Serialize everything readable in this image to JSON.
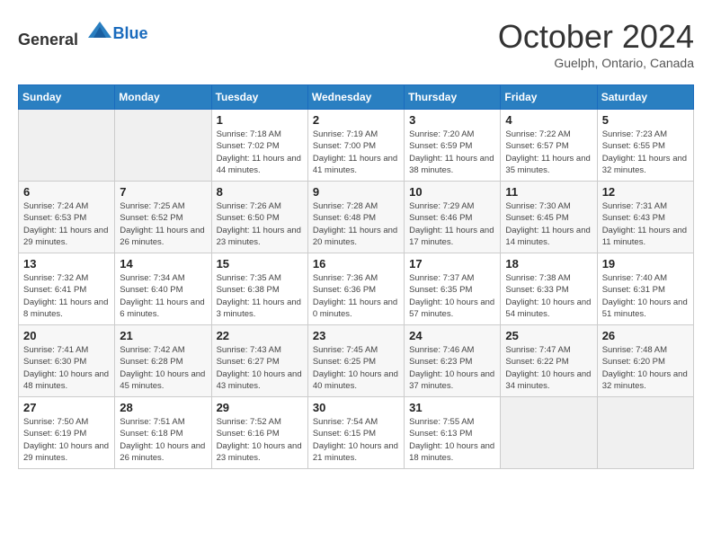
{
  "header": {
    "logo_general": "General",
    "logo_blue": "Blue",
    "month_title": "October 2024",
    "subtitle": "Guelph, Ontario, Canada"
  },
  "days_of_week": [
    "Sunday",
    "Monday",
    "Tuesday",
    "Wednesday",
    "Thursday",
    "Friday",
    "Saturday"
  ],
  "weeks": [
    [
      {
        "day": "",
        "sunrise": "",
        "sunset": "",
        "daylight": "",
        "empty": true
      },
      {
        "day": "",
        "sunrise": "",
        "sunset": "",
        "daylight": "",
        "empty": true
      },
      {
        "day": "1",
        "sunrise": "Sunrise: 7:18 AM",
        "sunset": "Sunset: 7:02 PM",
        "daylight": "Daylight: 11 hours and 44 minutes."
      },
      {
        "day": "2",
        "sunrise": "Sunrise: 7:19 AM",
        "sunset": "Sunset: 7:00 PM",
        "daylight": "Daylight: 11 hours and 41 minutes."
      },
      {
        "day": "3",
        "sunrise": "Sunrise: 7:20 AM",
        "sunset": "Sunset: 6:59 PM",
        "daylight": "Daylight: 11 hours and 38 minutes."
      },
      {
        "day": "4",
        "sunrise": "Sunrise: 7:22 AM",
        "sunset": "Sunset: 6:57 PM",
        "daylight": "Daylight: 11 hours and 35 minutes."
      },
      {
        "day": "5",
        "sunrise": "Sunrise: 7:23 AM",
        "sunset": "Sunset: 6:55 PM",
        "daylight": "Daylight: 11 hours and 32 minutes."
      }
    ],
    [
      {
        "day": "6",
        "sunrise": "Sunrise: 7:24 AM",
        "sunset": "Sunset: 6:53 PM",
        "daylight": "Daylight: 11 hours and 29 minutes."
      },
      {
        "day": "7",
        "sunrise": "Sunrise: 7:25 AM",
        "sunset": "Sunset: 6:52 PM",
        "daylight": "Daylight: 11 hours and 26 minutes."
      },
      {
        "day": "8",
        "sunrise": "Sunrise: 7:26 AM",
        "sunset": "Sunset: 6:50 PM",
        "daylight": "Daylight: 11 hours and 23 minutes."
      },
      {
        "day": "9",
        "sunrise": "Sunrise: 7:28 AM",
        "sunset": "Sunset: 6:48 PM",
        "daylight": "Daylight: 11 hours and 20 minutes."
      },
      {
        "day": "10",
        "sunrise": "Sunrise: 7:29 AM",
        "sunset": "Sunset: 6:46 PM",
        "daylight": "Daylight: 11 hours and 17 minutes."
      },
      {
        "day": "11",
        "sunrise": "Sunrise: 7:30 AM",
        "sunset": "Sunset: 6:45 PM",
        "daylight": "Daylight: 11 hours and 14 minutes."
      },
      {
        "day": "12",
        "sunrise": "Sunrise: 7:31 AM",
        "sunset": "Sunset: 6:43 PM",
        "daylight": "Daylight: 11 hours and 11 minutes."
      }
    ],
    [
      {
        "day": "13",
        "sunrise": "Sunrise: 7:32 AM",
        "sunset": "Sunset: 6:41 PM",
        "daylight": "Daylight: 11 hours and 8 minutes."
      },
      {
        "day": "14",
        "sunrise": "Sunrise: 7:34 AM",
        "sunset": "Sunset: 6:40 PM",
        "daylight": "Daylight: 11 hours and 6 minutes."
      },
      {
        "day": "15",
        "sunrise": "Sunrise: 7:35 AM",
        "sunset": "Sunset: 6:38 PM",
        "daylight": "Daylight: 11 hours and 3 minutes."
      },
      {
        "day": "16",
        "sunrise": "Sunrise: 7:36 AM",
        "sunset": "Sunset: 6:36 PM",
        "daylight": "Daylight: 11 hours and 0 minutes."
      },
      {
        "day": "17",
        "sunrise": "Sunrise: 7:37 AM",
        "sunset": "Sunset: 6:35 PM",
        "daylight": "Daylight: 10 hours and 57 minutes."
      },
      {
        "day": "18",
        "sunrise": "Sunrise: 7:38 AM",
        "sunset": "Sunset: 6:33 PM",
        "daylight": "Daylight: 10 hours and 54 minutes."
      },
      {
        "day": "19",
        "sunrise": "Sunrise: 7:40 AM",
        "sunset": "Sunset: 6:31 PM",
        "daylight": "Daylight: 10 hours and 51 minutes."
      }
    ],
    [
      {
        "day": "20",
        "sunrise": "Sunrise: 7:41 AM",
        "sunset": "Sunset: 6:30 PM",
        "daylight": "Daylight: 10 hours and 48 minutes."
      },
      {
        "day": "21",
        "sunrise": "Sunrise: 7:42 AM",
        "sunset": "Sunset: 6:28 PM",
        "daylight": "Daylight: 10 hours and 45 minutes."
      },
      {
        "day": "22",
        "sunrise": "Sunrise: 7:43 AM",
        "sunset": "Sunset: 6:27 PM",
        "daylight": "Daylight: 10 hours and 43 minutes."
      },
      {
        "day": "23",
        "sunrise": "Sunrise: 7:45 AM",
        "sunset": "Sunset: 6:25 PM",
        "daylight": "Daylight: 10 hours and 40 minutes."
      },
      {
        "day": "24",
        "sunrise": "Sunrise: 7:46 AM",
        "sunset": "Sunset: 6:23 PM",
        "daylight": "Daylight: 10 hours and 37 minutes."
      },
      {
        "day": "25",
        "sunrise": "Sunrise: 7:47 AM",
        "sunset": "Sunset: 6:22 PM",
        "daylight": "Daylight: 10 hours and 34 minutes."
      },
      {
        "day": "26",
        "sunrise": "Sunrise: 7:48 AM",
        "sunset": "Sunset: 6:20 PM",
        "daylight": "Daylight: 10 hours and 32 minutes."
      }
    ],
    [
      {
        "day": "27",
        "sunrise": "Sunrise: 7:50 AM",
        "sunset": "Sunset: 6:19 PM",
        "daylight": "Daylight: 10 hours and 29 minutes."
      },
      {
        "day": "28",
        "sunrise": "Sunrise: 7:51 AM",
        "sunset": "Sunset: 6:18 PM",
        "daylight": "Daylight: 10 hours and 26 minutes."
      },
      {
        "day": "29",
        "sunrise": "Sunrise: 7:52 AM",
        "sunset": "Sunset: 6:16 PM",
        "daylight": "Daylight: 10 hours and 23 minutes."
      },
      {
        "day": "30",
        "sunrise": "Sunrise: 7:54 AM",
        "sunset": "Sunset: 6:15 PM",
        "daylight": "Daylight: 10 hours and 21 minutes."
      },
      {
        "day": "31",
        "sunrise": "Sunrise: 7:55 AM",
        "sunset": "Sunset: 6:13 PM",
        "daylight": "Daylight: 10 hours and 18 minutes."
      },
      {
        "day": "",
        "sunrise": "",
        "sunset": "",
        "daylight": "",
        "empty": true
      },
      {
        "day": "",
        "sunrise": "",
        "sunset": "",
        "daylight": "",
        "empty": true
      }
    ]
  ]
}
